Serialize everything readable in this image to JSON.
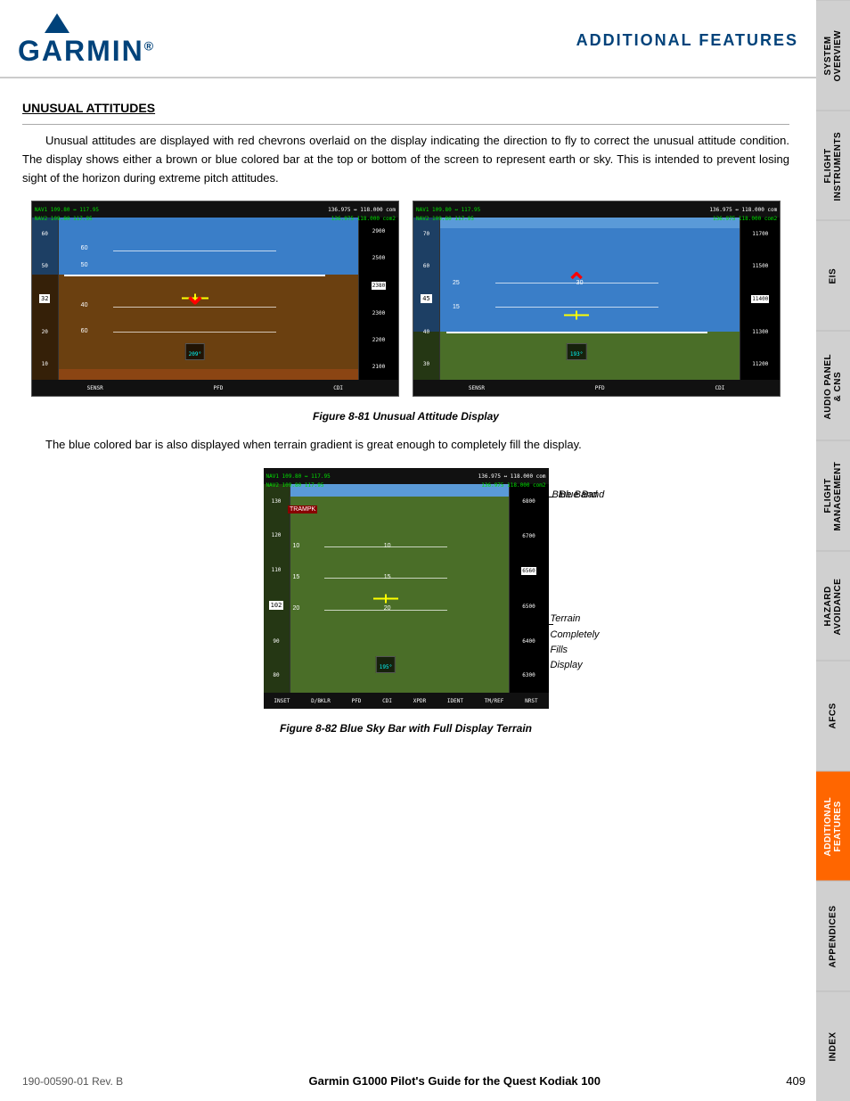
{
  "header": {
    "logo_text": "GARMIN",
    "logo_reg": "®",
    "title": "ADDITIONAL FEATURES"
  },
  "section": {
    "title": "UNUSUAL ATTITUDES",
    "body1": "Unusual attitudes are displayed with red chevrons overlaid on the display indicating the direction to fly to correct the unusual attitude condition.  The display shows either a brown or blue colored bar at the top or bottom of the screen to represent earth or sky.  This is intended to prevent losing sight of the horizon during extreme pitch attitudes.",
    "figure81_caption": "Figure 8-81  Unusual Attitude Display",
    "body2": "The blue colored bar is also displayed when terrain gradient is great enough to completely fill the display.",
    "figure82_caption": "Figure 8-82  Blue Sky Bar with Full Display Terrain",
    "annotation_blue_band": "Blue Band",
    "annotation_terrain": "Terrain\nCompletely\nFills Display"
  },
  "sidebar": {
    "tabs": [
      {
        "label": "SYSTEM\nOVERVIEW",
        "active": false
      },
      {
        "label": "FLIGHT\nINSTRUMENTS",
        "active": false
      },
      {
        "label": "EIS",
        "active": false
      },
      {
        "label": "AUDIO PANEL\n& CNS",
        "active": false
      },
      {
        "label": "FLIGHT\nMANAGEMENT",
        "active": false
      },
      {
        "label": "HAZARD\nAVOIDANCE",
        "active": false
      },
      {
        "label": "AFCS",
        "active": false
      },
      {
        "label": "ADDITIONAL\nFEATURES",
        "active": true
      },
      {
        "label": "APPENDICES",
        "active": false
      },
      {
        "label": "INDEX",
        "active": false
      }
    ]
  },
  "footer": {
    "left": "190-00590-01  Rev. B",
    "center": "Garmin G1000 Pilot's Guide for the Quest Kodiak 100",
    "right": "409"
  },
  "cockpit_display1": {
    "nav1": "NAV1 109.80 ↔ 117.95",
    "nav2": "NAV2 109.80   117.95",
    "freq": "136.975 ↔ 118.000 COM",
    "freq2": "136.975        118.000 COM2",
    "heading": "209°",
    "altitudes": [
      "2900",
      "2500",
      "2380",
      "2300",
      "2200",
      "2100"
    ],
    "softkeys": [
      "SENSR",
      "PFD",
      "CDI"
    ]
  },
  "cockpit_display2": {
    "nav1": "NAV1 109.80 ↔ 117.95",
    "nav2": "NAV2 109.80   117.95",
    "freq": "136.975 ↔ 118.000 COM",
    "freq2": "136.975        118.000 COM2",
    "heading": "193°",
    "altitudes": [
      "11700",
      "11500",
      "11400",
      "11300",
      "11200"
    ],
    "softkeys": [
      "SENSR",
      "PFD",
      "CDI"
    ]
  },
  "cockpit_display3": {
    "nav1": "NAV1 109.80 ↔ 117.95",
    "nav2": "NAV2 109.80   117.95",
    "freq": "136.975 ↔ 118.000 COM",
    "freq2": "136.975        118.000 COM2",
    "heading": "195°",
    "altitudes": [
      "6800",
      "6700",
      "6560",
      "6500",
      "6400",
      "6300"
    ],
    "softkeys": [
      "INSET",
      "D/BKLR",
      "PFD",
      "CDI",
      "XPDR",
      "IDENT",
      "TM/REF",
      "NRST"
    ]
  }
}
